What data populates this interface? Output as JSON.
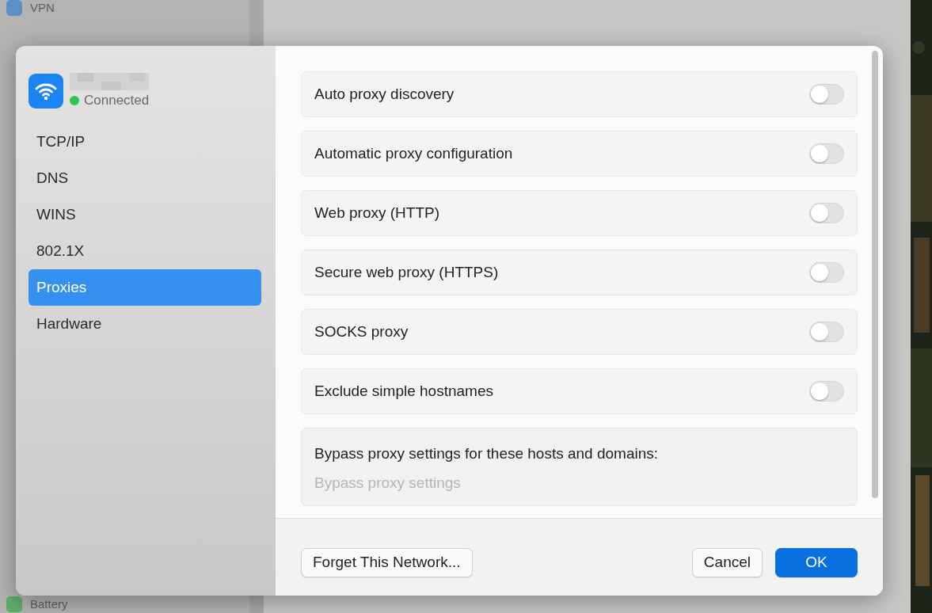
{
  "background": {
    "sidebar_items": [
      {
        "label": "VPN"
      },
      {
        "label": "Battery"
      }
    ]
  },
  "sheet": {
    "network": {
      "status": "Connected",
      "connected": true
    },
    "sidebar": [
      {
        "label": "TCP/IP",
        "selected": false
      },
      {
        "label": "DNS",
        "selected": false
      },
      {
        "label": "WINS",
        "selected": false
      },
      {
        "label": "802.1X",
        "selected": false
      },
      {
        "label": "Proxies",
        "selected": true
      },
      {
        "label": "Hardware",
        "selected": false
      }
    ],
    "settings": [
      {
        "label": "Auto proxy discovery",
        "on": false
      },
      {
        "label": "Automatic proxy configuration",
        "on": false
      },
      {
        "label": "Web proxy (HTTP)",
        "on": false
      },
      {
        "label": "Secure web proxy (HTTPS)",
        "on": false
      },
      {
        "label": "SOCKS proxy",
        "on": false
      },
      {
        "label": "Exclude simple hostnames",
        "on": false
      }
    ],
    "bypass": {
      "label": "Bypass proxy settings for these hosts and domains:",
      "placeholder": "Bypass proxy settings"
    },
    "buttons": [
      {
        "label": "Forget This Network...",
        "kind": "secondary"
      },
      {
        "label": "Cancel",
        "kind": "secondary"
      },
      {
        "label": "OK",
        "kind": "primary"
      }
    ]
  }
}
